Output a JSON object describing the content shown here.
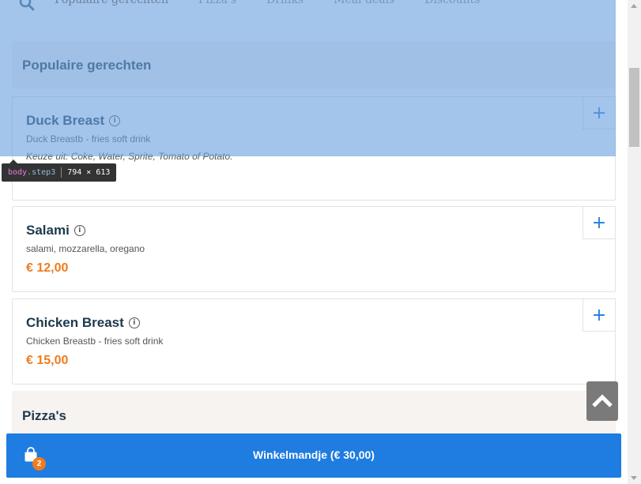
{
  "nav": {
    "tabs": [
      "Populaire gerechten",
      "Pizza's",
      "Drinks",
      "Meal deals",
      "Discounts"
    ],
    "icon": "search-icon"
  },
  "sections": {
    "popular": "Populaire gerechten",
    "pizzas": "Pizza's"
  },
  "items": [
    {
      "name": "Duck Breast",
      "description": "Duck Breastb - fries soft drink",
      "choice": "Keuze uit: Coke, Water, Sprite, Tomato of Potato."
    },
    {
      "name": "Salami",
      "description": "salami, mozzarella, oregano",
      "price": "€ 12,00"
    },
    {
      "name": "Chicken Breast",
      "description": "Chicken Breastb - fries soft drink",
      "price": "€ 15,00"
    }
  ],
  "inspector": {
    "tag": "body",
    "cls": ".step3",
    "size": "794 × 613"
  },
  "cart": {
    "label": "Winkelmandje (€ 30,00)",
    "count": "2"
  },
  "colors": {
    "accent": "#1f7ce0",
    "price": "#f07c1e",
    "overlay": "#6aa0de"
  }
}
